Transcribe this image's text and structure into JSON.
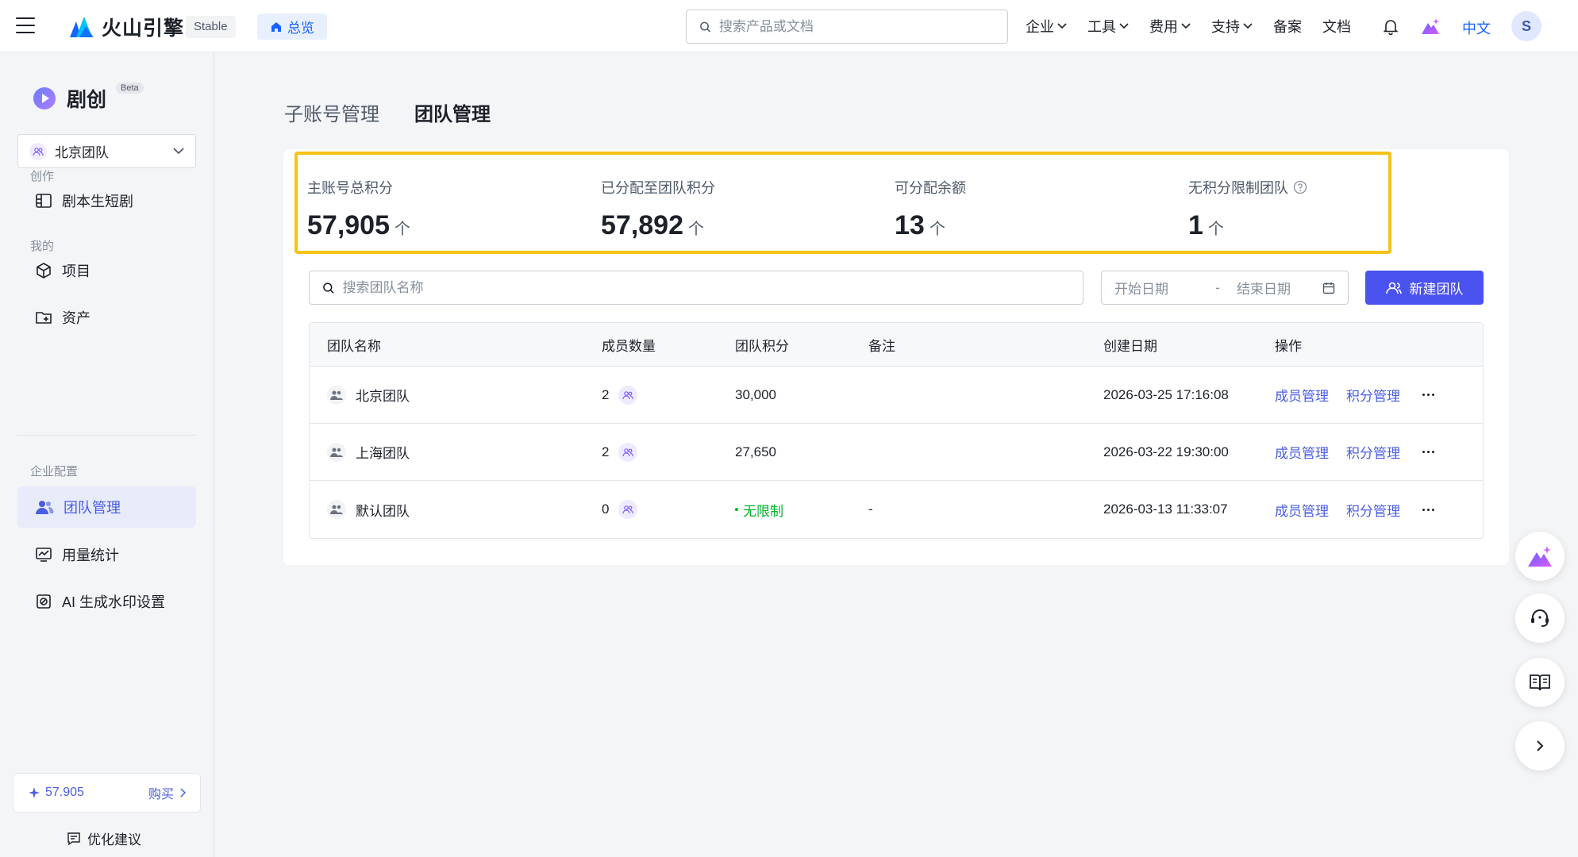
{
  "header": {
    "brand_name": "火山引擎",
    "env_tag": "Stable",
    "overview_label": "总览",
    "search_placeholder": "搜索产品或文档",
    "nav": [
      {
        "label": "企业",
        "has_dropdown": true
      },
      {
        "label": "工具",
        "has_dropdown": true
      },
      {
        "label": "费用",
        "has_dropdown": true
      },
      {
        "label": "支持",
        "has_dropdown": true
      },
      {
        "label": "备案",
        "has_dropdown": false
      },
      {
        "label": "文档",
        "has_dropdown": false
      }
    ],
    "language": "中文",
    "avatar_initial": "S",
    "accent_color": "#1664ff"
  },
  "sidebar": {
    "app_name": "剧创",
    "app_badge": "Beta",
    "team_selector": "北京团队",
    "sections": [
      {
        "label": "创作",
        "items": [
          {
            "label": "剧本生短剧",
            "icon": "storyboard-icon"
          }
        ]
      },
      {
        "label": "我的",
        "items": [
          {
            "label": "项目",
            "icon": "cube-icon"
          },
          {
            "label": "资产",
            "icon": "asset-folder-icon"
          }
        ]
      },
      {
        "label": "企业配置",
        "items": [
          {
            "label": "团队管理",
            "icon": "team-icon",
            "active": true
          },
          {
            "label": "用量统计",
            "icon": "usage-chart-icon"
          },
          {
            "label": "AI 生成水印设置",
            "icon": "watermark-icon"
          }
        ]
      }
    ],
    "credits": "57.905",
    "buy_label": "购买",
    "feedback_label": "优化建议",
    "active_color": "#4a5de3"
  },
  "main": {
    "tabs": [
      {
        "label": "子账号管理",
        "active": false
      },
      {
        "label": "团队管理",
        "active": true
      }
    ],
    "stats": [
      {
        "label": "主账号总积分",
        "value": "57,905",
        "unit": "个"
      },
      {
        "label": "已分配至团队积分",
        "value": "57,892",
        "unit": "个"
      },
      {
        "label": "可分配余额",
        "value": "13",
        "unit": "个"
      },
      {
        "label": "无积分限制团队",
        "value": "1",
        "unit": "个",
        "help": true
      }
    ],
    "team_search_placeholder": "搜索团队名称",
    "date_start_placeholder": "开始日期",
    "date_separator": "-",
    "date_end_placeholder": "结束日期",
    "new_team_label": "新建团队",
    "table": {
      "columns": [
        "团队名称",
        "成员数量",
        "团队积分",
        "备注",
        "创建日期",
        "操作"
      ],
      "rows": [
        {
          "name": "北京团队",
          "members": "2",
          "points": "30,000",
          "points_unlimited": false,
          "note": "",
          "created": "2026-03-25 17:16:08",
          "op1": "成员管理",
          "op2": "积分管理"
        },
        {
          "name": "上海团队",
          "members": "2",
          "points": "27,650",
          "points_unlimited": false,
          "note": "",
          "created": "2026-03-22 19:30:00",
          "op1": "成员管理",
          "op2": "积分管理"
        },
        {
          "name": "默认团队",
          "members": "0",
          "points": "无限制",
          "points_unlimited": true,
          "note": "-",
          "created": "2026-03-13 11:33:07",
          "op1": "成员管理",
          "op2": "积分管理"
        }
      ]
    },
    "highlight_color": "#f5c216",
    "primary_button_color": "#4a52f0"
  }
}
